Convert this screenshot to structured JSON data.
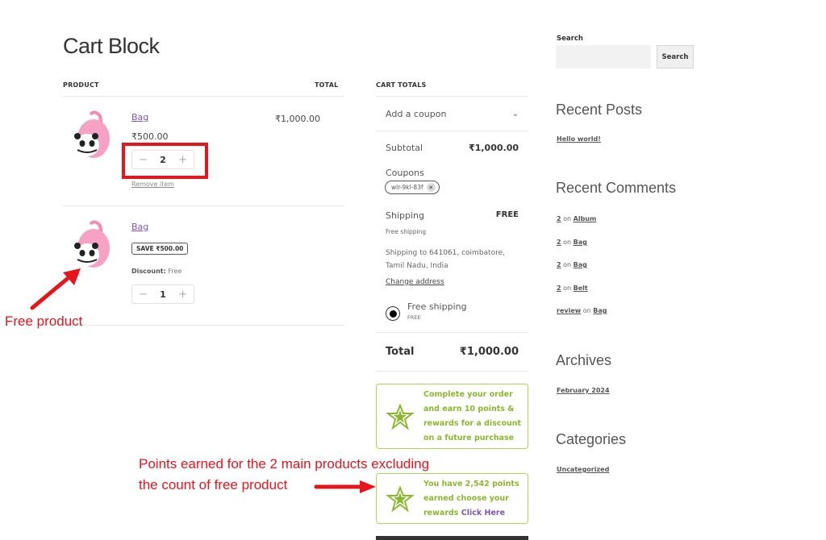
{
  "page": {
    "title": "Cart Block"
  },
  "cart": {
    "headers": {
      "product": "PRODUCT",
      "total": "TOTAL"
    },
    "items": [
      {
        "name": "Bag",
        "unit_price": "₹500.00",
        "quantity": "2",
        "line_total": "₹1,000.00",
        "remove_label": "Remove item",
        "image": "pink-panda-backpack"
      },
      {
        "name": "Bag",
        "save_badge": "SAVE ₹500.00",
        "discount_label": "Discount:",
        "discount_value": "Free",
        "quantity": "1",
        "image": "pink-panda-backpack"
      }
    ],
    "qty_minus": "−",
    "qty_plus": "+"
  },
  "totals": {
    "header": "CART TOTALS",
    "add_coupon": "Add a coupon",
    "subtotal_label": "Subtotal",
    "subtotal_value": "₹1,000.00",
    "coupons_label": "Coupons",
    "coupon_code": "wlr-9kl-83f",
    "shipping_label": "Shipping",
    "shipping_value": "FREE",
    "shipping_method": "Free shipping",
    "shipping_address": "Shipping to 641061, coimbatore, Tamil Nadu, India",
    "change_address": "Change address",
    "option_label": "Free shipping",
    "option_price": "FREE",
    "total_label": "Total",
    "total_value": "₹1,000.00"
  },
  "rewards": {
    "earn_message": "Complete your order and earn 10 points & rewards for a discount on a future purchase",
    "points_prefix": "You have 2,542 points earned choose your rewards",
    "points_link": "Click Here",
    "accent_color": "#8ab82d"
  },
  "sidebar": {
    "search_label": "Search",
    "search_placeholder": "",
    "search_button": "Search",
    "recent_posts_title": "Recent Posts",
    "recent_posts": [
      "Hello world!"
    ],
    "recent_comments_title": "Recent Comments",
    "recent_comments": [
      {
        "author": "2",
        "on": "on",
        "post": "Album"
      },
      {
        "author": "2",
        "on": "on",
        "post": "Bag"
      },
      {
        "author": "2",
        "on": "on",
        "post": "Bag"
      },
      {
        "author": "2",
        "on": "on",
        "post": "Belt"
      },
      {
        "author": "review",
        "on": "on",
        "post": "Bag"
      }
    ],
    "archives_title": "Archives",
    "archives": [
      "February 2024"
    ],
    "categories_title": "Categories",
    "categories": [
      "Uncategorized"
    ]
  },
  "annotations": {
    "free_product": "Free product",
    "points_note_line1": "Points earned for the 2 main products excluding",
    "points_note_line2": "the count of free product",
    "color": "#e8141b"
  }
}
